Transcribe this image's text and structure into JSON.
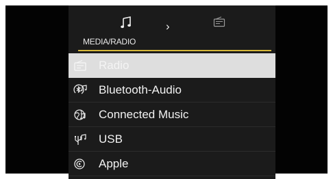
{
  "header": {
    "title": "MEDIA/RADIO",
    "icons": [
      "music-note-icon",
      "chevron-right-icon",
      "radio-icon"
    ],
    "chevron": "›",
    "accent_color": "#d7b93a"
  },
  "menu": {
    "selected_index": 0,
    "items": [
      {
        "label": "Radio",
        "icon": "radio-icon"
      },
      {
        "label": "Bluetooth-Audio",
        "icon": "bluetooth-audio-icon"
      },
      {
        "label": "Connected Music",
        "icon": "connected-music-icon"
      },
      {
        "label": "USB",
        "icon": "usb-audio-icon"
      },
      {
        "label": "Apple",
        "icon": "apple-carplay-icon"
      }
    ]
  },
  "colors": {
    "background": "#030303",
    "panel": "#1b1b1b",
    "selected_row": "#dedede",
    "text": "#f2f2f2"
  }
}
